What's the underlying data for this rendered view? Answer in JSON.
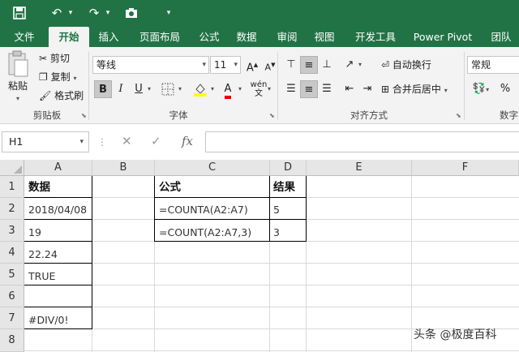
{
  "qat": {
    "save_icon": "save-icon",
    "undo_icon": "undo-icon",
    "redo_icon": "redo-icon",
    "camera_icon": "camera-icon",
    "customize_icon": "customize-qat-icon"
  },
  "tabs": [
    {
      "label": "文件"
    },
    {
      "label": "开始"
    },
    {
      "label": "插入"
    },
    {
      "label": "页面布局"
    },
    {
      "label": "公式"
    },
    {
      "label": "数据"
    },
    {
      "label": "审阅"
    },
    {
      "label": "视图"
    },
    {
      "label": "开发工具"
    },
    {
      "label": "Power Pivot"
    },
    {
      "label": "团队"
    }
  ],
  "ribbon": {
    "clipboard": {
      "paste": "粘贴",
      "cut": "剪切",
      "copy": "复制",
      "format_painter": "格式刷",
      "label": "剪贴板"
    },
    "font": {
      "name": "等线",
      "size": "11",
      "label": "字体"
    },
    "alignment": {
      "wrap": "自动换行",
      "merge": "合并后居中",
      "label": "对齐方式"
    },
    "number": {
      "format": "常规",
      "label": "数字"
    }
  },
  "formula_bar": {
    "name_box": "H1",
    "content": ""
  },
  "columns": [
    "A",
    "B",
    "C",
    "D",
    "E",
    "F"
  ],
  "rows": [
    "1",
    "2",
    "3",
    "4",
    "5",
    "6",
    "7",
    "8"
  ],
  "cells": {
    "A1": "数据",
    "A2": "2018/04/08",
    "A3": "19",
    "A4": "22.24",
    "A5": "TRUE",
    "A6": "",
    "A7": "#DIV/0!",
    "C1": "公式",
    "C2": "=COUNTA(A2:A7)",
    "C3": "=COUNT(A2:A7,3)",
    "D1": "结果",
    "D2": "5",
    "D3": "3"
  },
  "watermark": "头条 @极度百科",
  "colors": {
    "accent": "#217346",
    "ribbon_bg": "#f3f3f3",
    "header_bg": "#e6e6e6"
  }
}
